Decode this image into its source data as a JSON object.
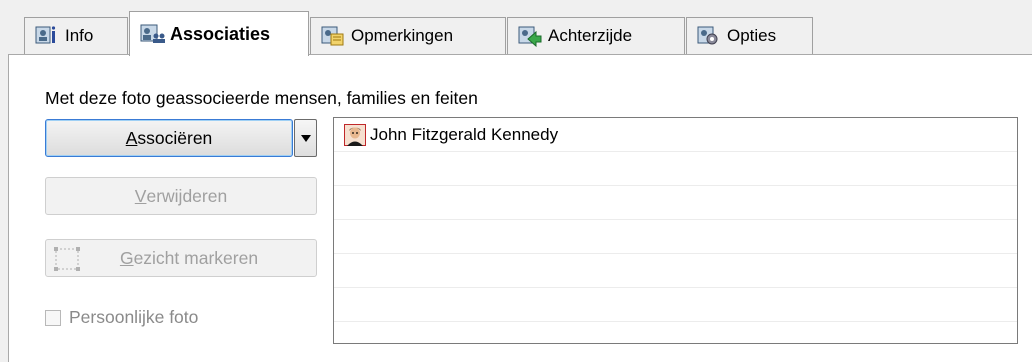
{
  "tabs": [
    {
      "label": "Info",
      "icon": "info-icon",
      "active": false
    },
    {
      "label": "Associaties",
      "icon": "people-icon",
      "active": true
    },
    {
      "label": "Opmerkingen",
      "icon": "notes-icon",
      "active": false
    },
    {
      "label": "Achterzijde",
      "icon": "photo-back-icon",
      "active": false
    },
    {
      "label": "Opties",
      "icon": "options-icon",
      "active": false
    }
  ],
  "section": {
    "caption": "Met deze foto geassocieerde mensen, families en feiten"
  },
  "buttons": {
    "associate": {
      "accel": "A",
      "rest": "ssociëren"
    },
    "remove": {
      "accel": "V",
      "rest": "erwijderen"
    },
    "mark_face": {
      "accel": "G",
      "rest": "ezicht markeren"
    }
  },
  "checkbox": {
    "label": "Persoonlijke foto",
    "checked": false
  },
  "associations": [
    {
      "name": "John Fitzgerald Kennedy",
      "icon": "person-icon"
    }
  ],
  "colors": {
    "accent": "#3a7bd5",
    "disabled_text": "#a0a0a0",
    "tab_bg": "#f0f0f0"
  }
}
